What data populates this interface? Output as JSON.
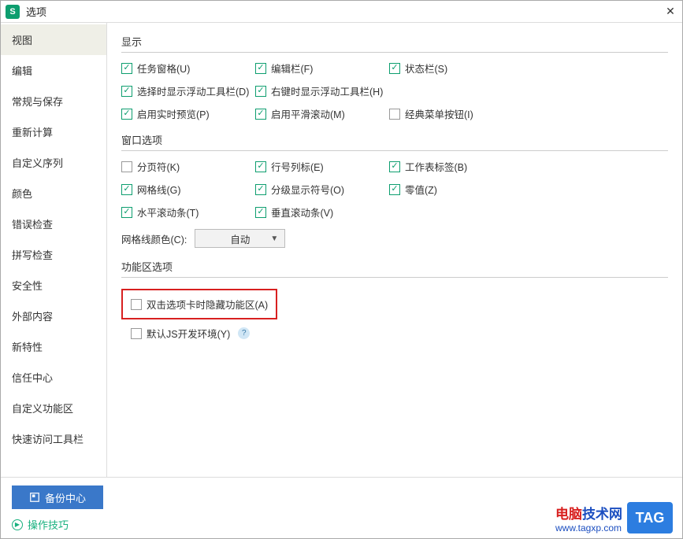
{
  "titlebar": {
    "title": "选项"
  },
  "sidebar": {
    "items": [
      {
        "label": "视图",
        "active": true
      },
      {
        "label": "编辑"
      },
      {
        "label": "常规与保存"
      },
      {
        "label": "重新计算"
      },
      {
        "label": "自定义序列"
      },
      {
        "label": "颜色"
      },
      {
        "label": "错误检查"
      },
      {
        "label": "拼写检查"
      },
      {
        "label": "安全性"
      },
      {
        "label": "外部内容"
      },
      {
        "label": "新特性"
      },
      {
        "label": "信任中心"
      },
      {
        "label": "自定义功能区"
      },
      {
        "label": "快速访问工具栏"
      }
    ]
  },
  "groups": {
    "display": {
      "title": "显示",
      "items": [
        {
          "label": "任务窗格(U)",
          "checked": true
        },
        {
          "label": "编辑栏(F)",
          "checked": true
        },
        {
          "label": "状态栏(S)",
          "checked": true
        },
        {
          "label": "选择时显示浮动工具栏(D)",
          "checked": true
        },
        {
          "label": "右键时显示浮动工具栏(H)",
          "checked": true
        },
        {
          "label": "",
          "checked": null
        },
        {
          "label": "启用实时预览(P)",
          "checked": true
        },
        {
          "label": "启用平滑滚动(M)",
          "checked": true
        },
        {
          "label": "经典菜单按钮(I)",
          "checked": false
        }
      ]
    },
    "window": {
      "title": "窗口选项",
      "items": [
        {
          "label": "分页符(K)",
          "checked": false
        },
        {
          "label": "行号列标(E)",
          "checked": true
        },
        {
          "label": "工作表标签(B)",
          "checked": true
        },
        {
          "label": "网格线(G)",
          "checked": true
        },
        {
          "label": "分级显示符号(O)",
          "checked": true
        },
        {
          "label": "零值(Z)",
          "checked": true
        },
        {
          "label": "水平滚动条(T)",
          "checked": true
        },
        {
          "label": "垂直滚动条(V)",
          "checked": true
        }
      ],
      "gridcolor_label": "网格线颜色(C):",
      "gridcolor_value": "自动"
    },
    "ribbon": {
      "title": "功能区选项",
      "hide_on_dblclick": {
        "label": "双击选项卡时隐藏功能区(A)",
        "checked": false
      },
      "default_js": {
        "label": "默认JS开发环境(Y)",
        "checked": false
      }
    }
  },
  "footer": {
    "backup": "备份中心",
    "tips": "操作技巧"
  },
  "watermark": {
    "line1a": "电脑",
    "line1b": "技术网",
    "line2": "www.tagxp.com",
    "tag": "TAG"
  }
}
